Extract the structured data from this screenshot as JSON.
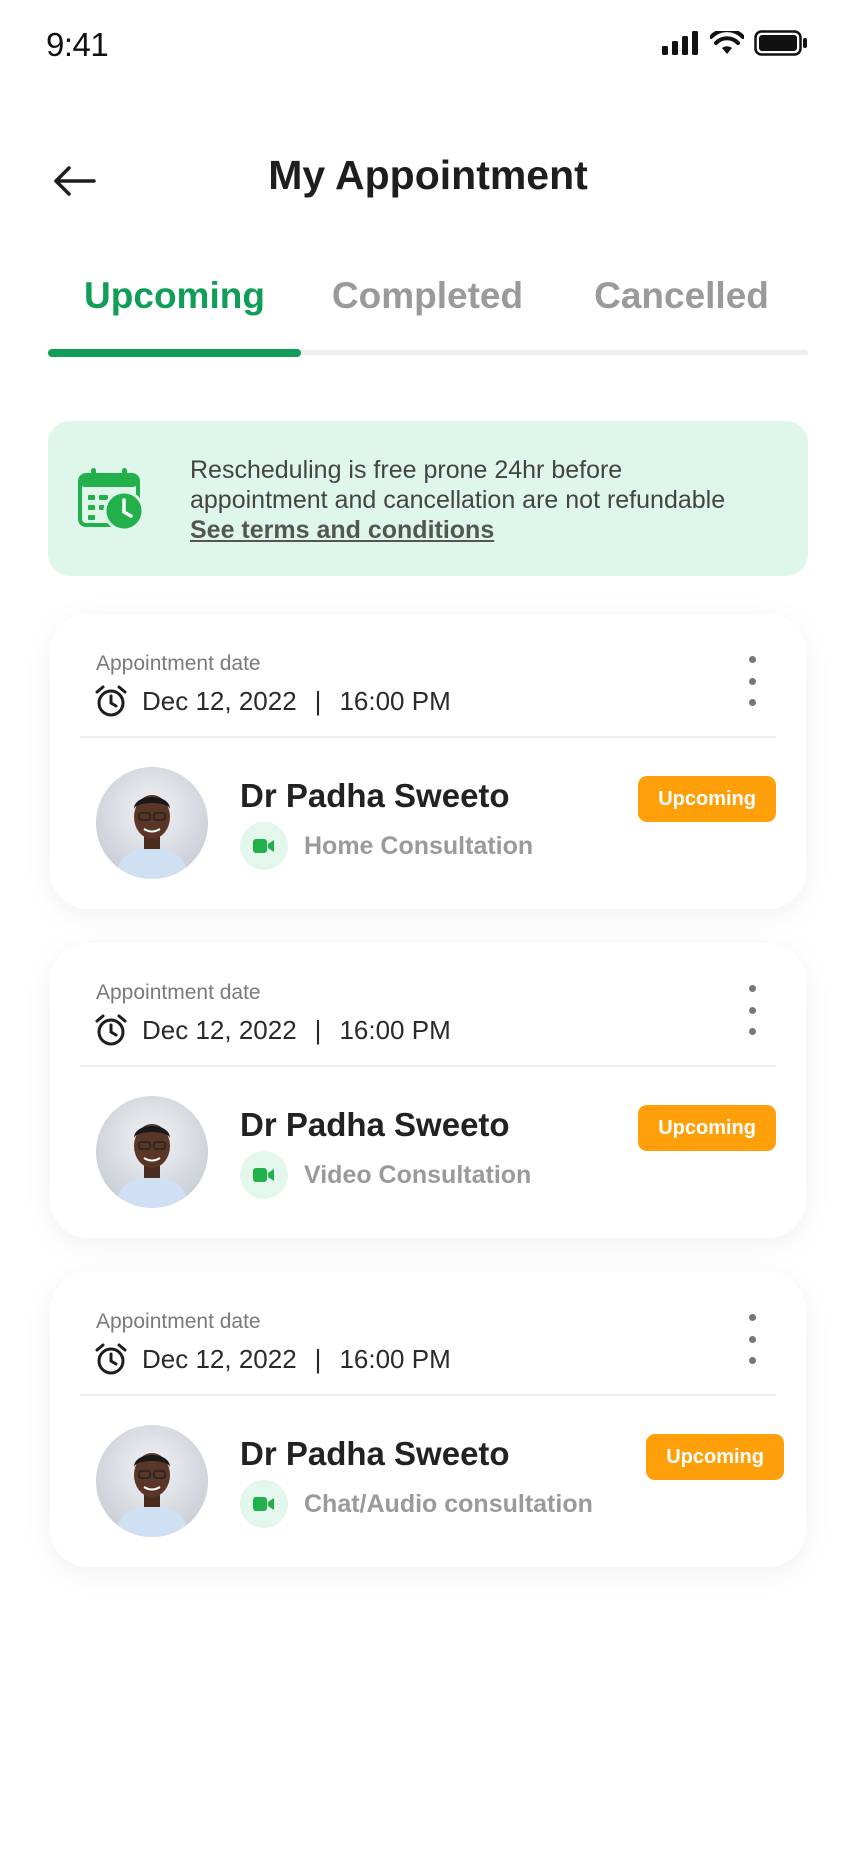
{
  "status_bar": {
    "time": "9:41"
  },
  "header": {
    "title": "My Appointment"
  },
  "tabs": [
    {
      "label": "Upcoming",
      "active": true
    },
    {
      "label": "Completed",
      "active": false
    },
    {
      "label": "Cancelled",
      "active": false
    }
  ],
  "notice": {
    "line1": "Rescheduling is free prone 24hr before",
    "line2": "appointment and cancellation are not refundable",
    "link": "See terms and conditions"
  },
  "colors": {
    "accent": "#0f9d58",
    "badge": "#ff9f0a",
    "notice_bg": "#dff6ea"
  },
  "appointments": [
    {
      "date_label": "Appointment date",
      "date": "Dec 12, 2022",
      "separator": "|",
      "time": "16:00 PM",
      "doctor": "Dr Padha Sweeto",
      "consultation": "Home Consultation",
      "status": "Upcoming"
    },
    {
      "date_label": "Appointment date",
      "date": "Dec 12, 2022",
      "separator": "|",
      "time": "16:00 PM",
      "doctor": "Dr Padha Sweeto",
      "consultation": "Video Consultation",
      "status": "Upcoming"
    },
    {
      "date_label": "Appointment date",
      "date": "Dec 12, 2022",
      "separator": "|",
      "time": "16:00 PM",
      "doctor": "Dr Padha Sweeto",
      "consultation": "Chat/Audio consultation",
      "status": "Upcoming"
    }
  ]
}
